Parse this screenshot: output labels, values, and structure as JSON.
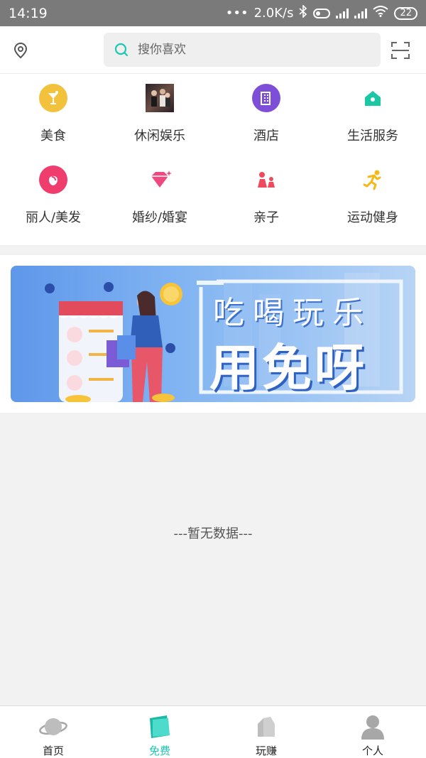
{
  "status_bar": {
    "time": "14:19",
    "dots": "•••",
    "network_speed": "2.0K/s",
    "battery": "22"
  },
  "header": {
    "search_placeholder": "搜你喜欢"
  },
  "categories": [
    {
      "label": "美食",
      "icon": "cocktail-icon",
      "color": "#f2c23c"
    },
    {
      "label": "休闲娱乐",
      "icon": "entertainment-photo",
      "color": "#3b2a30"
    },
    {
      "label": "酒店",
      "icon": "hotel-building-icon",
      "color": "#7d4fd8"
    },
    {
      "label": "生活服务",
      "icon": "home-service-icon",
      "color": "#1cc7a4"
    },
    {
      "label": "丽人/美发",
      "icon": "beauty-face-icon",
      "color": "#ef3d6e"
    },
    {
      "label": "婚纱/婚宴",
      "icon": "diamond-icon",
      "color": "#ef4a80"
    },
    {
      "label": "亲子",
      "icon": "parent-child-icon",
      "color": "#ef4a5d"
    },
    {
      "label": "运动健身",
      "icon": "running-icon",
      "color": "#f5b819"
    }
  ],
  "banner": {
    "line1": "吃喝玩乐",
    "line2": "用免呀"
  },
  "empty_text": "---暂无数据---",
  "tabbar": [
    {
      "label": "首页",
      "icon": "planet-icon",
      "active": false
    },
    {
      "label": "免费",
      "icon": "free-bag-icon",
      "active": true
    },
    {
      "label": "玩赚",
      "icon": "play-earn-icon",
      "active": false
    },
    {
      "label": "个人",
      "icon": "person-icon",
      "active": false
    }
  ]
}
